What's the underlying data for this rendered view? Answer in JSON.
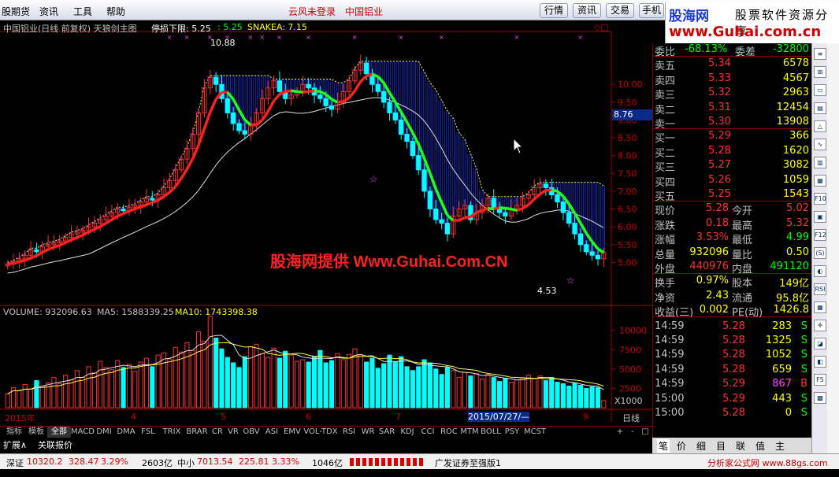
{
  "menu": {
    "items": [
      "股期货",
      "资讯",
      "工具",
      "帮助"
    ],
    "center_left": "云风未登录",
    "center_right": "中国铝业"
  },
  "top_buttons": [
    "行情",
    "资讯",
    "交易",
    "手机"
  ],
  "logo": {
    "brand": "股海网",
    "slogan": "股票软件资源分享",
    "url": "www.Guhai.com.cn"
  },
  "chart": {
    "title": "中国铝业(日线 前复权) 天狼剑主图",
    "stop_label": "停损下限: 5.25",
    "val_525": ": 5.25",
    "snakea": "SNAKEA: 7.15",
    "high_label": "10.88",
    "low_label": "4.53",
    "cursor_price": "8.76",
    "price_ticks": [
      "10.00",
      "9.50",
      "9.00",
      "8.50",
      "8.00",
      "7.50",
      "7.00",
      "6.50",
      "6.00",
      "5.50",
      "5.00"
    ],
    "volume_label": "VOLUME: 932096.63",
    "ma5_label": "MA5: 1588339.25",
    "ma10_label": "MA10: 1743398.38",
    "vol_ticks": [
      "10000",
      "7500",
      "5000",
      "2500"
    ],
    "vol_unit": "X1000",
    "date_labels": [
      "2015年",
      "4",
      "5",
      "6",
      "7",
      "9"
    ],
    "date_highlight": "2015/07/27/—",
    "period": "日线",
    "watermark": "股海网提供 Www.Guhai.Com.CN"
  },
  "chart_data": {
    "type": "candlestick",
    "price_min": 4.53,
    "price_max": 10.88,
    "closes": [
      4.95,
      5.0,
      5.1,
      5.2,
      5.35,
      5.3,
      5.45,
      5.5,
      5.55,
      5.6,
      5.7,
      5.8,
      5.85,
      5.9,
      6.0,
      6.1,
      6.2,
      6.3,
      6.4,
      6.5,
      6.45,
      6.55,
      6.6,
      6.7,
      6.8,
      6.75,
      6.9,
      7.1,
      7.3,
      7.6,
      7.9,
      8.2,
      8.6,
      9.2,
      9.9,
      10.2,
      10.0,
      9.6,
      9.2,
      8.9,
      8.7,
      8.6,
      8.9,
      9.2,
      9.6,
      9.9,
      10.1,
      9.8,
      9.6,
      9.7,
      9.8,
      10.0,
      9.9,
      9.7,
      9.6,
      9.4,
      9.3,
      9.5,
      9.8,
      10.1,
      10.4,
      10.6,
      10.3,
      10.0,
      9.8,
      9.5,
      9.2,
      9.0,
      8.6,
      8.4,
      8.0,
      7.6,
      7.0,
      6.5,
      6.2,
      6.1,
      5.8,
      6.3,
      6.5,
      6.6,
      6.2,
      6.4,
      6.6,
      6.8,
      6.5,
      6.4,
      6.3,
      6.5,
      6.6,
      6.8,
      6.9,
      7.1,
      7.2,
      7.1,
      6.9,
      6.7,
      6.4,
      6.1,
      5.8,
      5.5,
      5.3,
      5.2,
      5.1,
      5.28
    ],
    "volumes": [
      1800,
      2600,
      2200,
      3000,
      2400,
      3500,
      2800,
      3200,
      3900,
      3100,
      4200,
      3600,
      4800,
      3900,
      5300,
      4500,
      6000,
      5200,
      4900,
      6100,
      5200,
      5600,
      4700,
      5900,
      6400,
      5300,
      6800,
      7100,
      6300,
      7800,
      7200,
      8400,
      7400,
      9800,
      8600,
      11800,
      9000,
      7600,
      6500,
      5800,
      5200,
      6600,
      7900,
      8200,
      7000,
      6500,
      7700,
      6400,
      7300,
      6800,
      6000,
      6200,
      5900,
      6600,
      7400,
      5800,
      6100,
      7000,
      6200,
      6900,
      7600,
      6800,
      5900,
      6400,
      5100,
      5700,
      6800,
      5900,
      6600,
      5300,
      4800,
      5300,
      6200,
      5800,
      5000,
      4300,
      5200,
      4800,
      3900,
      4600,
      4100,
      4400,
      3700,
      4300,
      3900,
      3400,
      3800,
      3300,
      3600,
      3900,
      4200,
      3800,
      4100,
      3500,
      3900,
      3300,
      3100,
      2800,
      3200,
      2900,
      2500,
      2700,
      2600,
      932
    ]
  },
  "toolbar": {
    "tabs": [
      "指标",
      "模板",
      "全部",
      "MACD",
      "DMI",
      "DMA",
      "FSL",
      "TRIX",
      "BRAR",
      "CR",
      "VR",
      "OBV",
      "ASI",
      "EMV",
      "VOL-TDX",
      "RSI",
      "WR",
      "SAR",
      "KDJ",
      "CCI",
      "ROC",
      "MTM",
      "BOLL",
      "PSY",
      "MCST"
    ],
    "right": [
      "+",
      "-",
      "□"
    ]
  },
  "status_row": {
    "expand": "扩展∧",
    "link": "关联报价"
  },
  "quote": {
    "weibi": {
      "label": "委比",
      "value": "-68.13%",
      "label2": "委差",
      "value2": "-32800"
    },
    "asks": [
      {
        "label": "卖五",
        "price": "5.34",
        "vol": "6578"
      },
      {
        "label": "卖四",
        "price": "5.33",
        "vol": "4567"
      },
      {
        "label": "卖三",
        "price": "5.32",
        "vol": "2963"
      },
      {
        "label": "卖二",
        "price": "5.31",
        "vol": "12454"
      },
      {
        "label": "卖一",
        "price": "5.30",
        "vol": "13908"
      }
    ],
    "bids": [
      {
        "label": "买一",
        "price": "5.29",
        "vol": "366"
      },
      {
        "label": "买二",
        "price": "5.28",
        "vol": "1620"
      },
      {
        "label": "买三",
        "price": "5.27",
        "vol": "3082"
      },
      {
        "label": "买四",
        "price": "5.26",
        "vol": "1059"
      },
      {
        "label": "买五",
        "price": "5.25",
        "vol": "1543"
      }
    ],
    "stats": [
      {
        "l1": "现价",
        "v1": "5.28",
        "l2": "今开",
        "v2": "5.02"
      },
      {
        "l1": "涨跌",
        "v1": "0.18",
        "l2": "最高",
        "v2": "5.32"
      },
      {
        "l1": "涨幅",
        "v1": "3.53%",
        "l2": "最低",
        "v2": "4.99"
      },
      {
        "l1": "总量",
        "v1": "932096",
        "l2": "量比",
        "v2": "0.50"
      },
      {
        "l1": "外盘",
        "v1": "440976",
        "l2": "内盘",
        "v2": "491120"
      }
    ],
    "stats2": [
      {
        "l1": "换手",
        "v1": "0.97%",
        "l2": "股本",
        "v2": "149亿"
      },
      {
        "l1": "净资",
        "v1": "2.43",
        "l2": "流通",
        "v2": "95.8亿"
      },
      {
        "l1": "收益(三)",
        "v1": "0.002",
        "l2": "PE(动)",
        "v2": "1426.8"
      }
    ],
    "ticks": [
      {
        "time": "14:59",
        "price": "5.28",
        "vol": "283",
        "bs": "S"
      },
      {
        "time": "14:59",
        "price": "5.28",
        "vol": "1325",
        "bs": "S"
      },
      {
        "time": "14:59",
        "price": "5.28",
        "vol": "1052",
        "bs": "S"
      },
      {
        "time": "14:59",
        "price": "5.28",
        "vol": "659",
        "bs": "S"
      },
      {
        "time": "14:59",
        "price": "5.29",
        "vol": "867",
        "bs": "B"
      },
      {
        "time": "15:00",
        "price": "5.29",
        "vol": "443",
        "bs": "S"
      },
      {
        "time": "15:00",
        "price": "5.28",
        "vol": "0",
        "bs": "S"
      }
    ],
    "tabs": [
      "笔",
      "价",
      "细",
      "目",
      "联",
      "值",
      "主"
    ]
  },
  "sidebar_icons": [
    "≡",
    "⊞",
    "▭",
    "▤",
    "△",
    "∿",
    "▥",
    "▦",
    "F10",
    "▣",
    "F12",
    "(S)",
    "◐",
    "RSI",
    "▦",
    "✛",
    "◪",
    "◧",
    "F5",
    "▩"
  ],
  "bottom": {
    "sz_label": "深证",
    "sz_val": "10320.2",
    "sz_chg": "328.47",
    "sz_pct": "3.29%",
    "sz_amt": "2603亿",
    "zx_label": "中小",
    "zx_val": "7013.54",
    "zx_chg": "225.81",
    "zx_pct": "3.33%",
    "zx_amt": "1046亿",
    "broker": "广发证券至强版1",
    "ad": "分析家公式网 www.88gs.com"
  }
}
